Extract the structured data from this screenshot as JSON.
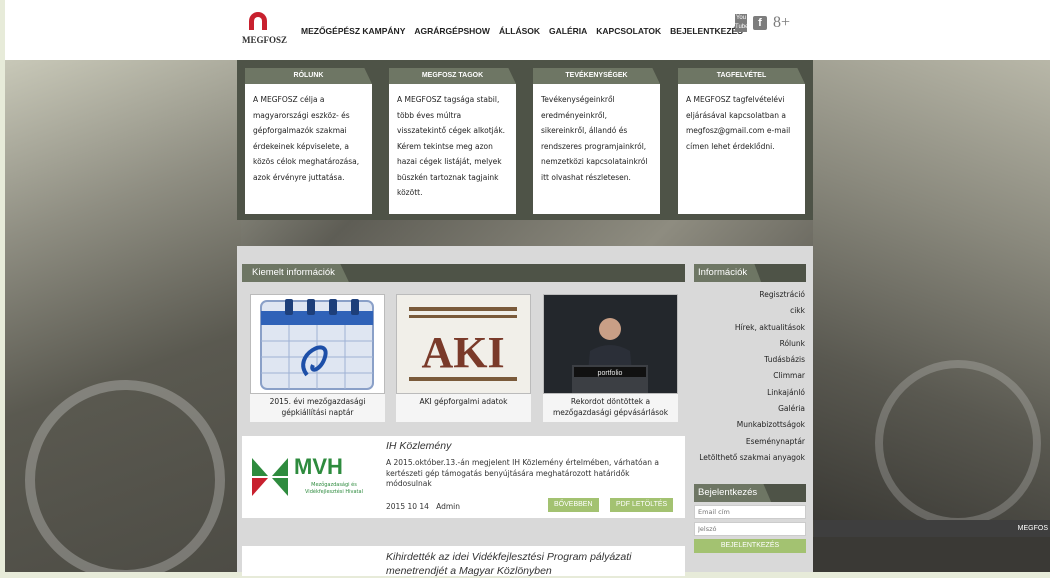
{
  "brand": {
    "logo_text": "MEGFOSZ"
  },
  "nav": [
    "MEZŐGÉPÉSZ KAMPÁNY",
    "AGRÁRGÉPSHOW",
    "ÁLLÁSOK",
    "GALÉRIA",
    "KAPCSOLATOK",
    "BEJELENTKEZÉS"
  ],
  "social": {
    "youtube": "You Tube",
    "facebook": "f",
    "gplus": "8+"
  },
  "columns": [
    {
      "title": "RÓLUNK",
      "text": "A MEGFOSZ célja a magyarországi eszköz- és gépforgalmazók szakmai érdekeinek képviselete, a közös célok meghatározása, azok érvényre juttatása."
    },
    {
      "title": "MEGFOSZ TAGOK",
      "text": "A MEGFOSZ tagsága stabil, több éves múltra visszatekintő cégek alkotják. Kérem tekintse meg azon hazai cégek listáját, melyek büszkén tartoznak tagjaink között."
    },
    {
      "title": "TEVÉKENYSÉGEK",
      "text": "Tevékenységeinkről eredményeinkről, sikereinkről, állandó és rendszeres programjainkról, nemzetközi kapcsolatainkról itt olvashat részletesen."
    },
    {
      "title": "TAGFELVÉTEL",
      "text": "A MEGFOSZ tagfelvételévi eljárásával kapcsolatban a megfosz@gmail.com e-mail címen lehet érdeklődni."
    }
  ],
  "featured": {
    "heading": "Kiemelt információk",
    "cards": [
      {
        "caption": "2015. évi mezőgazdasági gépkiállítási naptár"
      },
      {
        "caption": "AKI gépforgalmi adatok",
        "logo_text": "AKI"
      },
      {
        "caption": "Rekordot döntöttek a mezőgazdasági gépvásárlások",
        "sign": "portfolio"
      }
    ]
  },
  "news": [
    {
      "title": "IH Közlemény",
      "desc": "A 2015.október.13.-án megjelent IH Közlemény értelmében, várhatóan a kertészeti gép támogatás benyújtására meghatározott határidők módosulnak",
      "date": "2015 10 14",
      "author": "Admin",
      "more": "BŐVEBBEN",
      "pdf": "PDF LETÖLTÉS",
      "logo_big": "MVH",
      "logo_small": "Mezőgazdasági és Vidékfejlesztési Hivatal"
    },
    {
      "title": "Kihirdették az idei Vidékfejlesztési Program pályázati menetrendjét a Magyar Közlönyben"
    }
  ],
  "sidebar": {
    "heading": "Információk",
    "items": [
      "Regisztráció",
      "cikk",
      "Hírek, aktualitások",
      "Rólunk",
      "Tudásbázis",
      "Climmar",
      "Linkajánló",
      "Galéria",
      "Munkabizottságok",
      "Eseménynaptár",
      "Letölthető szakmai anyagok"
    ]
  },
  "login": {
    "heading": "Bejelentkezés",
    "email_placeholder": "Email cím",
    "password_placeholder": "Jelszó",
    "button": "BEJELENTKEZÉS"
  },
  "footer_strip": "MEGFOS",
  "colors": {
    "header_dark": "#4e5347",
    "tab": "#6e7664",
    "accent_green": "#a3c271",
    "logo_red": "#c8202e",
    "mvh_green": "#2e8b3e"
  }
}
